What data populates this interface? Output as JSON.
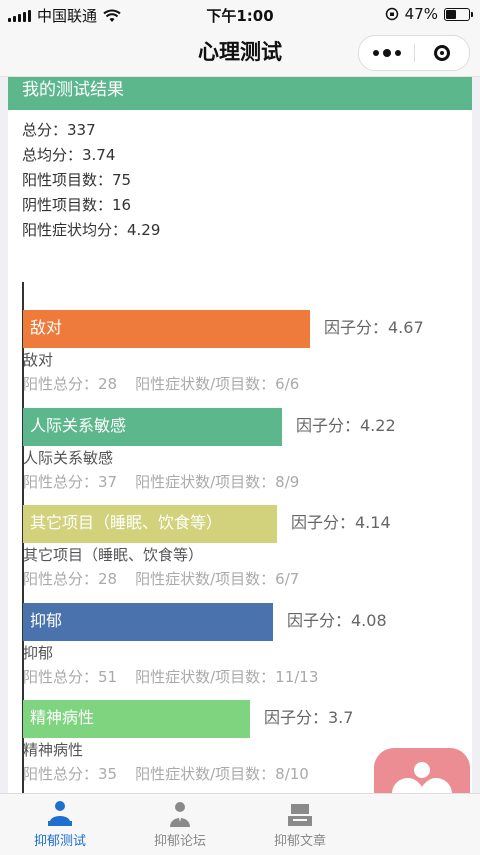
{
  "status_bar": {
    "carrier": "中国联通",
    "time": "下午1:00",
    "battery": "47%",
    "battery_level": 0.47
  },
  "nav": {
    "title": "心理测试"
  },
  "result": {
    "header": "我的测试结果",
    "summary": [
      "总分：337",
      "总均分：3.74",
      "阳性项目数：75",
      "阴性项目数：16",
      "阳性症状均分：4.29"
    ]
  },
  "chart_data": {
    "type": "bar",
    "orientation": "horizontal",
    "categories": [
      "敌对",
      "人际关系敏感",
      "其它项目（睡眠、饮食等）",
      "抑郁",
      "精神病性"
    ],
    "values": [
      4.67,
      4.22,
      4.14,
      4.08,
      3.7
    ],
    "colors": [
      "#ee7a3c",
      "#5cb88c",
      "#d2d27c",
      "#4a72ac",
      "#7fd57f"
    ],
    "value_label_prefix": "因子分：",
    "details": [
      {
        "name": "敌对",
        "positive_total": "阳性总分：28",
        "ratio": "阳性症状数/项目数：6/6"
      },
      {
        "name": "人际关系敏感",
        "positive_total": "阳性总分：37",
        "ratio": "阳性症状数/项目数：8/9"
      },
      {
        "name": "其它项目（睡眠、饮食等）",
        "positive_total": "阳性总分：28",
        "ratio": "阳性症状数/项目数：6/7"
      },
      {
        "name": "抑郁",
        "positive_total": "阳性总分：51",
        "ratio": "阳性症状数/项目数：11/13"
      },
      {
        "name": "精神病性",
        "positive_total": "阳性总分：35",
        "ratio": "阳性症状数/项目数：8/10"
      }
    ]
  },
  "tabs": [
    {
      "label": "抑郁测试",
      "icon": "test-person-icon",
      "active": true
    },
    {
      "label": "抑郁论坛",
      "icon": "forum-person-icon",
      "active": false
    },
    {
      "label": "抑郁文章",
      "icon": "article-icon",
      "active": false
    }
  ],
  "fab": {
    "icon": "heart-person-icon"
  }
}
